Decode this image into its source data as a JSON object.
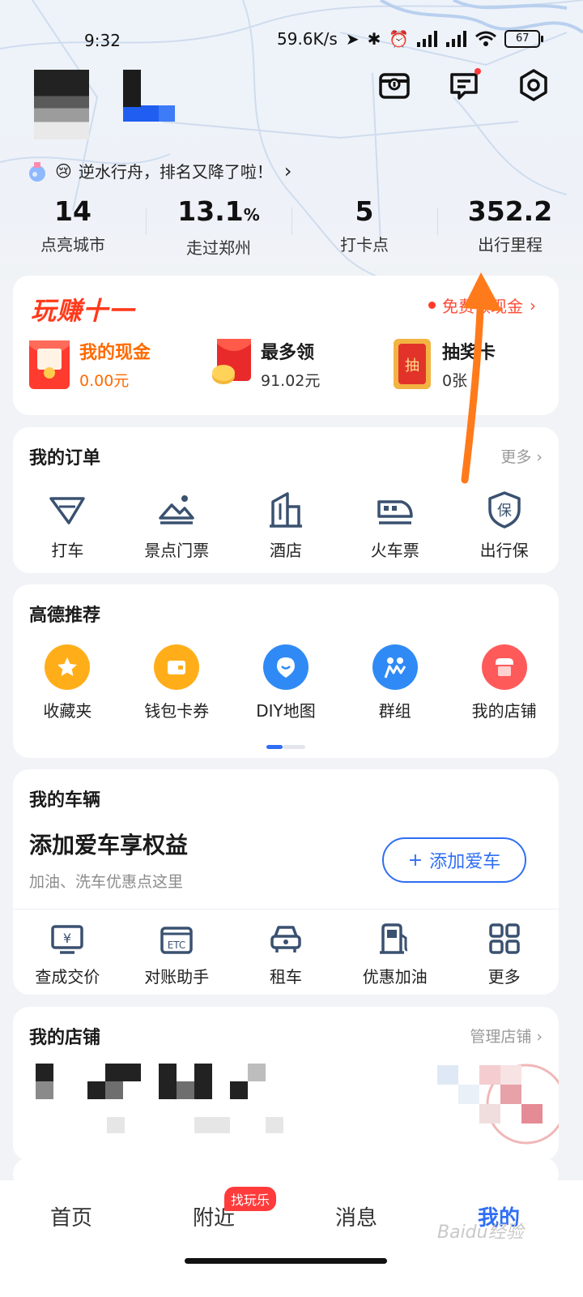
{
  "status_bar": {
    "time": "9:32",
    "speed": "59.6K/s",
    "battery": "67",
    "icons": [
      "location-icon",
      "bluetooth-icon",
      "alarm-icon",
      "signal-icon",
      "signal-hd-icon",
      "wifi-icon",
      "battery-icon"
    ]
  },
  "header": {
    "rank_text": "逆水行舟，排名又降了啦！",
    "rank_chevron": "›",
    "icons": [
      "wallet-box-icon",
      "message-icon",
      "settings-icon"
    ]
  },
  "stats": [
    {
      "value": "14",
      "unit": "",
      "label": "点亮城市"
    },
    {
      "value": "13.1",
      "unit": "%",
      "label": "走过郑州"
    },
    {
      "value": "5",
      "unit": "",
      "label": "打卡点"
    },
    {
      "value": "352.2",
      "unit": "",
      "label": "出行里程"
    }
  ],
  "promo": {
    "logo": "玩赚十一",
    "free_cash": "免费领现金",
    "items": [
      {
        "name": "我的现金",
        "value": "0.00元"
      },
      {
        "name": "最多领",
        "value": "91.02元"
      },
      {
        "name": "抽奖卡",
        "value": "0张"
      }
    ]
  },
  "orders": {
    "title": "我的订单",
    "more": "更多 ›",
    "items": [
      {
        "label": "打车",
        "icon": "taxi-icon"
      },
      {
        "label": "景点门票",
        "icon": "scenic-ticket-icon"
      },
      {
        "label": "酒店",
        "icon": "hotel-icon"
      },
      {
        "label": "火车票",
        "icon": "train-icon"
      },
      {
        "label": "出行保",
        "icon": "insurance-icon"
      }
    ]
  },
  "recommend": {
    "title": "高德推荐",
    "items": [
      {
        "label": "收藏夹",
        "icon": "favorites-icon",
        "color": "#ffae1a"
      },
      {
        "label": "钱包卡券",
        "icon": "wallet-icon",
        "color": "#ffae1a"
      },
      {
        "label": "DIY地图",
        "icon": "diy-map-icon",
        "color": "#2f8af5"
      },
      {
        "label": "群组",
        "icon": "group-icon",
        "color": "#2f8af5"
      },
      {
        "label": "我的店铺",
        "icon": "shop-icon",
        "color": "#ff5a5a"
      }
    ],
    "page_indicator": {
      "pages": 2,
      "active": 0
    }
  },
  "vehicle": {
    "title": "我的车辆",
    "headline": "添加爱车享权益",
    "subtitle": "加油、洗车优惠点这里",
    "add_button": "添加爱车",
    "items": [
      {
        "label": "查成交价",
        "icon": "price-check-icon"
      },
      {
        "label": "对账助手",
        "icon": "etc-icon"
      },
      {
        "label": "租车",
        "icon": "car-rental-icon"
      },
      {
        "label": "优惠加油",
        "icon": "fuel-icon"
      },
      {
        "label": "更多",
        "icon": "more-grid-icon"
      }
    ]
  },
  "shop": {
    "title": "我的店铺",
    "manage": "管理店铺 ›"
  },
  "tabbar": {
    "tabs": [
      "首页",
      "附近",
      "消息",
      "我的"
    ],
    "badge": "找玩乐",
    "active": "我的",
    "watermark": "Baidu经验"
  },
  "colors": {
    "accent_blue": "#2f6ef5",
    "promo_red": "#ff3a1c",
    "promo_orange": "#ff6a00",
    "annotation_arrow": "#ff7a1a"
  }
}
